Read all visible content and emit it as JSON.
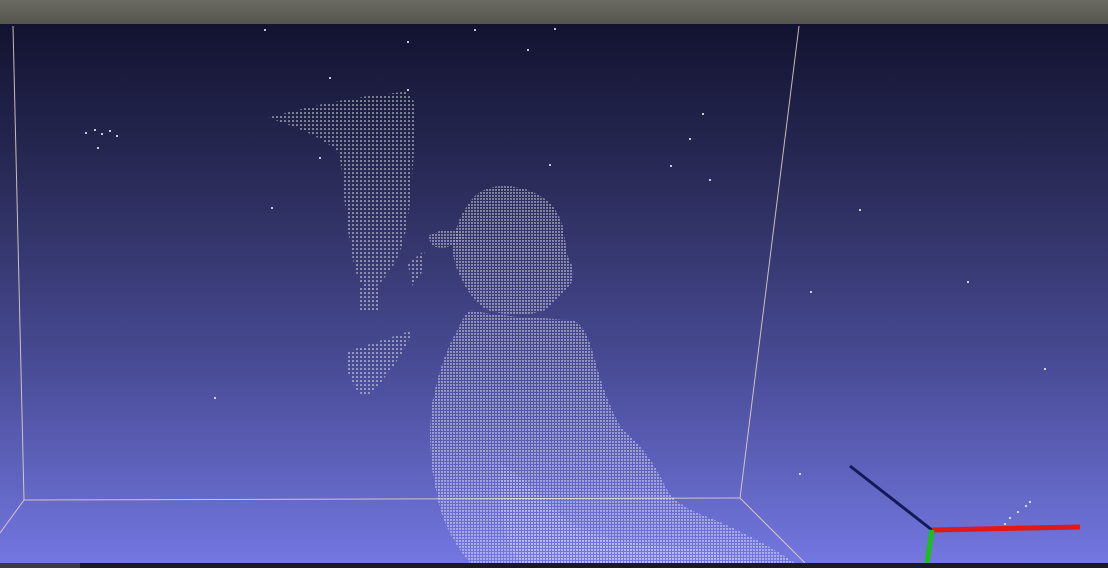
{
  "viewer": {
    "background_top": "#121330",
    "background_bottom": "#7377e0",
    "point_color": "#ffffff",
    "bounding_box_color": "#e8d6c6"
  },
  "axes": {
    "x_color": "#e01818",
    "y_color": "#18c018",
    "z_color": "#141a58"
  }
}
